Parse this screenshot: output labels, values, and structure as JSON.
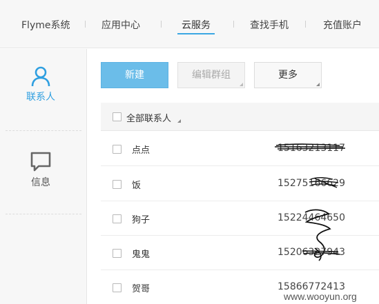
{
  "nav": {
    "items": [
      {
        "label": "Flyme系统"
      },
      {
        "label": "应用中心"
      },
      {
        "label": "云服务"
      },
      {
        "label": "查找手机"
      },
      {
        "label": "充值账户"
      }
    ],
    "active_index": 2,
    "accent_color": "#3aa7e3"
  },
  "sidebar": {
    "items": [
      {
        "label": "联系人",
        "icon": "person-icon",
        "active": true
      },
      {
        "label": "信息",
        "icon": "message-icon",
        "active": false
      }
    ]
  },
  "toolbar": {
    "new_label": "新建",
    "edit_group_label": "编辑群组",
    "more_label": "更多"
  },
  "table": {
    "select_all_label": "全部联系人",
    "rows": [
      {
        "name": "点点",
        "phone": "15163213117"
      },
      {
        "name": "饭",
        "phone": "15275166629"
      },
      {
        "name": "狗子",
        "phone": "15224464650"
      },
      {
        "name": "鬼鬼",
        "phone": "15206327943"
      },
      {
        "name": "贺哥",
        "phone": "15866772413"
      }
    ]
  },
  "watermark": "www.wooyun.org"
}
